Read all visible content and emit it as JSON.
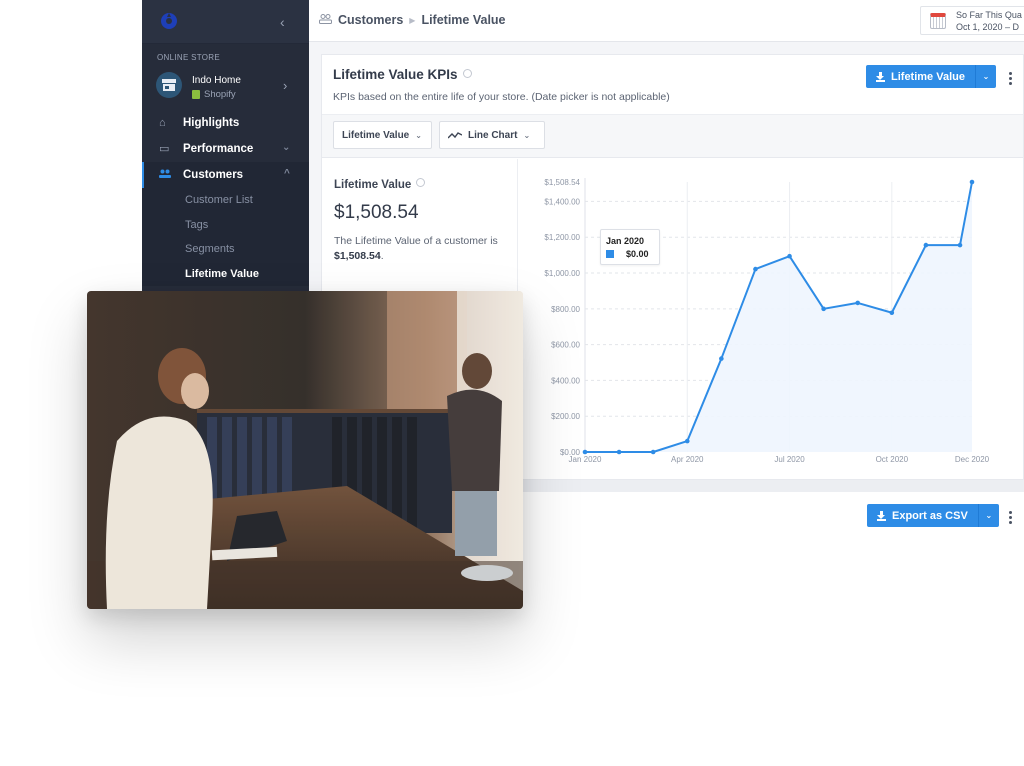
{
  "sidebar": {
    "logo": "brand-logo",
    "collapse_icon": "chevron-left-icon",
    "section_label": "ONLINE STORE",
    "store": {
      "name": "Indo Home",
      "platform": "Shopify"
    },
    "items": [
      {
        "label": "Highlights",
        "icon": "home-icon"
      },
      {
        "label": "Performance",
        "icon": "monitor-icon",
        "expanded": false
      },
      {
        "label": "Customers",
        "icon": "users-icon",
        "expanded": true,
        "active": true
      }
    ],
    "sub_items": [
      {
        "label": "Customer List"
      },
      {
        "label": "Tags"
      },
      {
        "label": "Segments"
      },
      {
        "label": "Lifetime Value",
        "current": true
      }
    ]
  },
  "header": {
    "breadcrumb": [
      "Customers",
      "Lifetime Value"
    ],
    "date_picker": {
      "label": "So Far This Qua",
      "range": "Oct 1, 2020 – D"
    }
  },
  "card": {
    "title": "Lifetime Value KPIs",
    "subtitle": "KPIs based on the entire life of your store. (Date picker is not applicable)",
    "download_button": "Lifetime Value",
    "metric_dropdown": "Lifetime Value",
    "chart_type_dropdown": "Line Chart",
    "kpi": {
      "label": "Lifetime Value",
      "value": "$1,508.54",
      "description_prefix": "The Lifetime Value of a customer is ",
      "description_value": "$1,508.54",
      "description_suffix": "."
    },
    "tooltip": {
      "title": "Jan 2020",
      "value": "$0.00"
    }
  },
  "export_button": "Export as CSV",
  "colors": {
    "accent": "#2e8ce6",
    "sidebar_bg": "#262c3a",
    "fill": "#eef5fe"
  },
  "chart_data": {
    "type": "line",
    "title": "",
    "xlabel": "",
    "ylabel": "",
    "x": [
      "Jan 2020",
      "Feb 2020",
      "Mar 2020",
      "Apr 2020",
      "May 2020",
      "Jun 2020",
      "Jul 2020",
      "Aug 2020",
      "Sep 2020",
      "Oct 2020",
      "Nov 2020",
      "Dec 2020",
      "Dec 2020 (current)"
    ],
    "series": [
      {
        "name": "Lifetime Value",
        "values": [
          0,
          0,
          0,
          61,
          522,
          1022,
          1094,
          800,
          833,
          778,
          1156,
          1156,
          1508.54
        ]
      }
    ],
    "x_tick_labels": [
      "Jan 2020",
      "Apr 2020",
      "Jul 2020",
      "Oct 2020",
      "Dec 2020"
    ],
    "x_tick_index": [
      0,
      3,
      6,
      9,
      12
    ],
    "y_tick_labels": [
      "$0.00",
      "$200.00",
      "$400.00",
      "$600.00",
      "$800.00",
      "$1,000.00",
      "$1,200.00",
      "$1,400.00",
      "$1,508.54"
    ],
    "y_tick_values": [
      0,
      200,
      400,
      600,
      800,
      1000,
      1200,
      1400,
      1508.54
    ],
    "ylim": [
      0,
      1508.54
    ],
    "grid": true,
    "area_fill": true,
    "legend": "none"
  }
}
